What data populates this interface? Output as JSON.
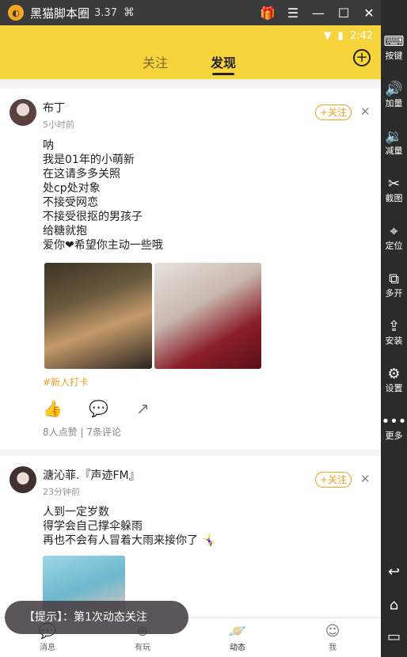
{
  "titlebar": {
    "app_name": "黑猫脚本圈",
    "version": "3.37",
    "gift_icon": "🎁",
    "menu_icon": "☰",
    "minimize_icon": "—",
    "maximize_icon": "☐",
    "close_icon": "✕",
    "collapse_icon": "«"
  },
  "sidebar": {
    "items": [
      {
        "icon": "⌨",
        "label": "按键"
      },
      {
        "icon": "🔊",
        "label": "加量"
      },
      {
        "icon": "🔉",
        "label": "减量"
      },
      {
        "icon": "✂",
        "label": "截图"
      },
      {
        "icon": "⌖",
        "label": "定位"
      },
      {
        "icon": "⧉",
        "label": "多开"
      },
      {
        "icon": "⇪",
        "label": "安装"
      },
      {
        "icon": "⚙",
        "label": "设置"
      },
      {
        "icon": "•••",
        "label": "更多"
      }
    ],
    "back_icon": "↩",
    "home_icon": "⌂",
    "recent_icon": "▭"
  },
  "status_bar": {
    "wifi_icon": "▼",
    "battery_icon": "▮",
    "time": "2:42"
  },
  "header": {
    "tab_follow": "关注",
    "tab_discover": "发现",
    "add_icon": "+"
  },
  "posts": [
    {
      "username": "布丁",
      "time": "5小时前",
      "follow_label": "+关注",
      "close_icon": "✕",
      "lines": [
        "呐",
        "我是01年的小萌新",
        "在这请多多关照",
        "处cp处对象",
        "不接受网恋",
        "不接受很抠的男孩子",
        "给糖就抱",
        "爱你❤希望你主动一些哦"
      ],
      "tag": "#新人打卡",
      "likes": "8人点赞",
      "separator": "|",
      "comments": "7条评论"
    },
    {
      "username": "溏沁菲.『声迹FM』",
      "time": "23分钟前",
      "follow_label": "+关注",
      "close_icon": "✕",
      "lines": [
        "人到一定岁数",
        "得学会自己撑伞躲雨",
        "再也不会有人冒着大雨来接你了 🤸‍♀️"
      ]
    }
  ],
  "action_icons": {
    "like": "👍",
    "comment": "💬",
    "share": "↗"
  },
  "bottom_nav": [
    {
      "label": "消息",
      "icon": "💬"
    },
    {
      "label": "有玩",
      "icon": "⊕"
    },
    {
      "label": "动态",
      "icon": "🪐"
    },
    {
      "label": "我",
      "icon": "☺"
    }
  ],
  "toast": "【提示】：第1次动态关注",
  "colors": {
    "accent": "#f7d43c",
    "follow": "#f0a020"
  }
}
